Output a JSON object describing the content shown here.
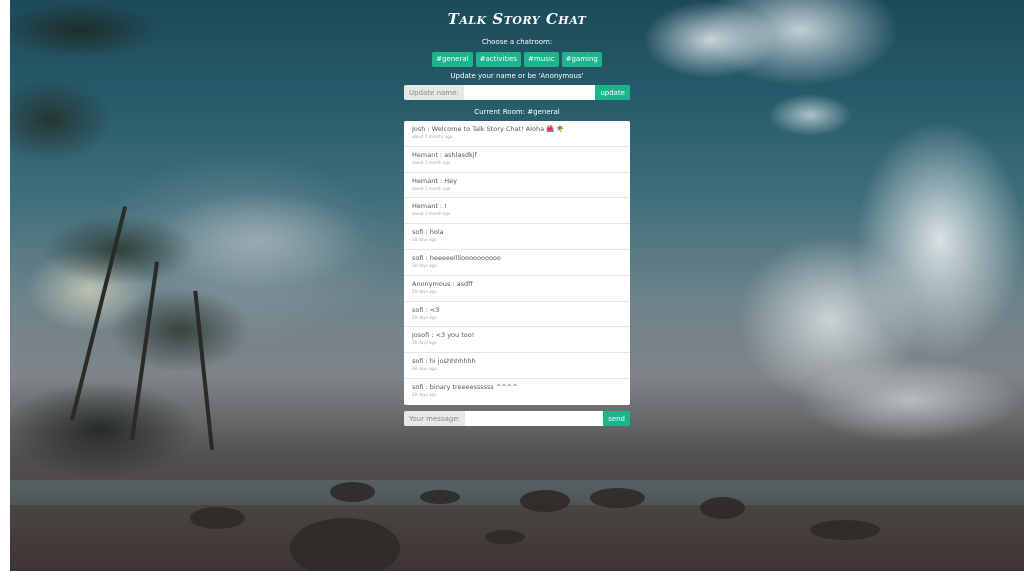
{
  "title": "Talk Story Chat",
  "chatroom": {
    "choose_label": "Choose a chatroom:",
    "rooms": [
      "#general",
      "#activities",
      "#music",
      "#gaming"
    ]
  },
  "name_form": {
    "label": "Update your name or be 'Anonymous'",
    "addon": "Update name:",
    "value": "",
    "button": "update"
  },
  "current_room": "Current Room: #general",
  "messages": [
    {
      "text": "Josh : Welcome to Talk Story Chat! Aloha 🌺 🌴",
      "time": "about 2 months ago"
    },
    {
      "text": "Hemant : ashlasdkjf",
      "time": "about 1 month ago"
    },
    {
      "text": "Hemant : Hey",
      "time": "about 1 month ago"
    },
    {
      "text": "Hemant : !",
      "time": "about 1 month ago"
    },
    {
      "text": "sofi : hola",
      "time": "28 days ago"
    },
    {
      "text": "sofi : heeeeelllloooooooooo",
      "time": "28 days ago"
    },
    {
      "text": "Anonymous : asdff",
      "time": "28 days ago"
    },
    {
      "text": "sofi : <3",
      "time": "28 days ago"
    },
    {
      "text": "josofi : <3 you too!",
      "time": "28 days ago"
    },
    {
      "text": "sofi : hi joshhhhhhh",
      "time": "28 days ago"
    },
    {
      "text": "sofi : binary treeeessssss ^^^^",
      "time": "28 days ago"
    }
  ],
  "message_form": {
    "addon": "Your message:",
    "value": "",
    "button": "send"
  },
  "colors": {
    "accent": "#1db38b"
  }
}
